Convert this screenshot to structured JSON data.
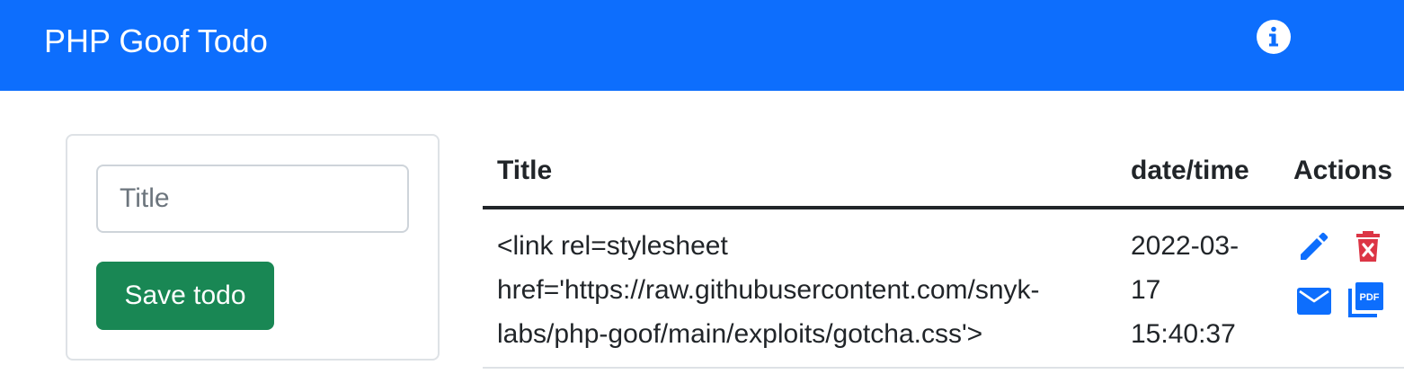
{
  "navbar": {
    "brand": "PHP Goof Todo",
    "info_icon": "info-circle-icon",
    "background_color": "#0d6efd"
  },
  "form": {
    "title_placeholder": "Title",
    "title_value": "",
    "save_label": "Save todo",
    "save_color": "#198754"
  },
  "table": {
    "headers": {
      "title": "Title",
      "datetime": "date/time",
      "actions": "Actions"
    },
    "rows": [
      {
        "title_lines": [
          "<link rel=stylesheet",
          "href='https://raw.githubusercontent.com/snyk-",
          "labs/php-goof/main/exploits/gotcha.css'>"
        ],
        "datetime_lines": [
          "2022-03-",
          "17",
          "15:40:37"
        ],
        "actions": {
          "edit_icon": "pencil-icon",
          "delete_icon": "trash-icon",
          "email_icon": "envelope-icon",
          "pdf_icon": "pdf-icon"
        }
      }
    ]
  },
  "colors": {
    "primary_action": "#0d6efd",
    "danger": "#dc3545"
  }
}
